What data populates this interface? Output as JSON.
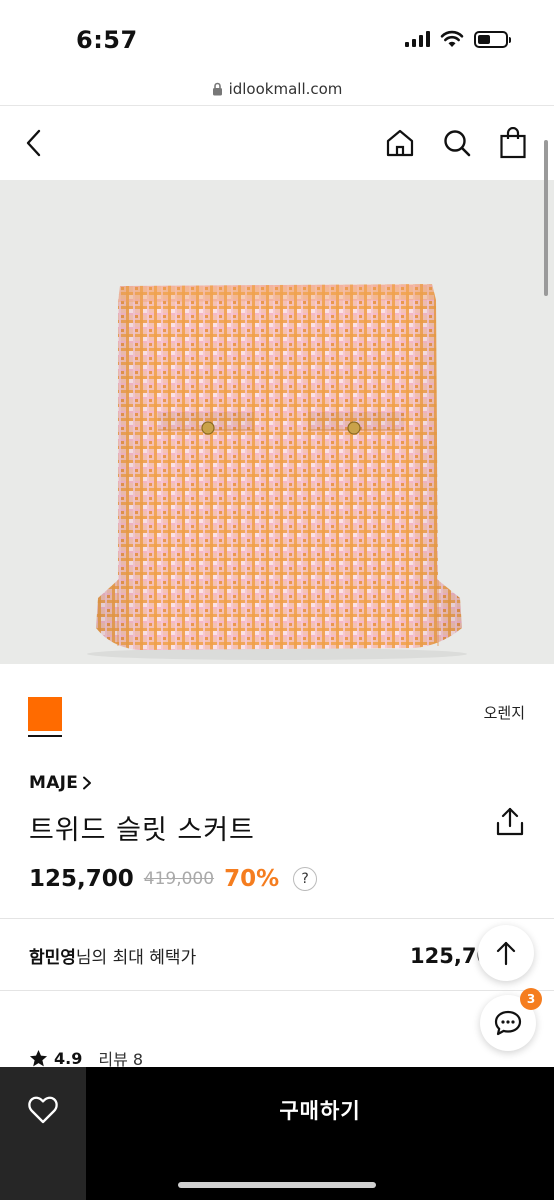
{
  "status_bar": {
    "time": "6:57"
  },
  "browser": {
    "url": "idlookmall.com"
  },
  "header": {
    "back": "back",
    "icons": [
      "home-icon",
      "search-icon",
      "shopping-bag-icon"
    ]
  },
  "product": {
    "color_hex": "#ff6b00",
    "color_name": "오렌지",
    "brand": "MAJE",
    "name": "트위드 슬릿 스커트",
    "price": "125,700",
    "original_price": "419,000",
    "discount": "70%",
    "help_label": "?"
  },
  "benefit": {
    "user_name": "함민영",
    "label_suffix": "님의 최대 혜택가",
    "price": "125,700원"
  },
  "rating": {
    "score": "4.9",
    "review_label": "리뷰 8"
  },
  "chat": {
    "badge_count": "3"
  },
  "bottom_bar": {
    "buy_label": "구매하기"
  },
  "colors": {
    "accent_orange": "#f57d1f",
    "tweed_orange": "#f3a35c",
    "tweed_pink": "#f4b7c4"
  }
}
